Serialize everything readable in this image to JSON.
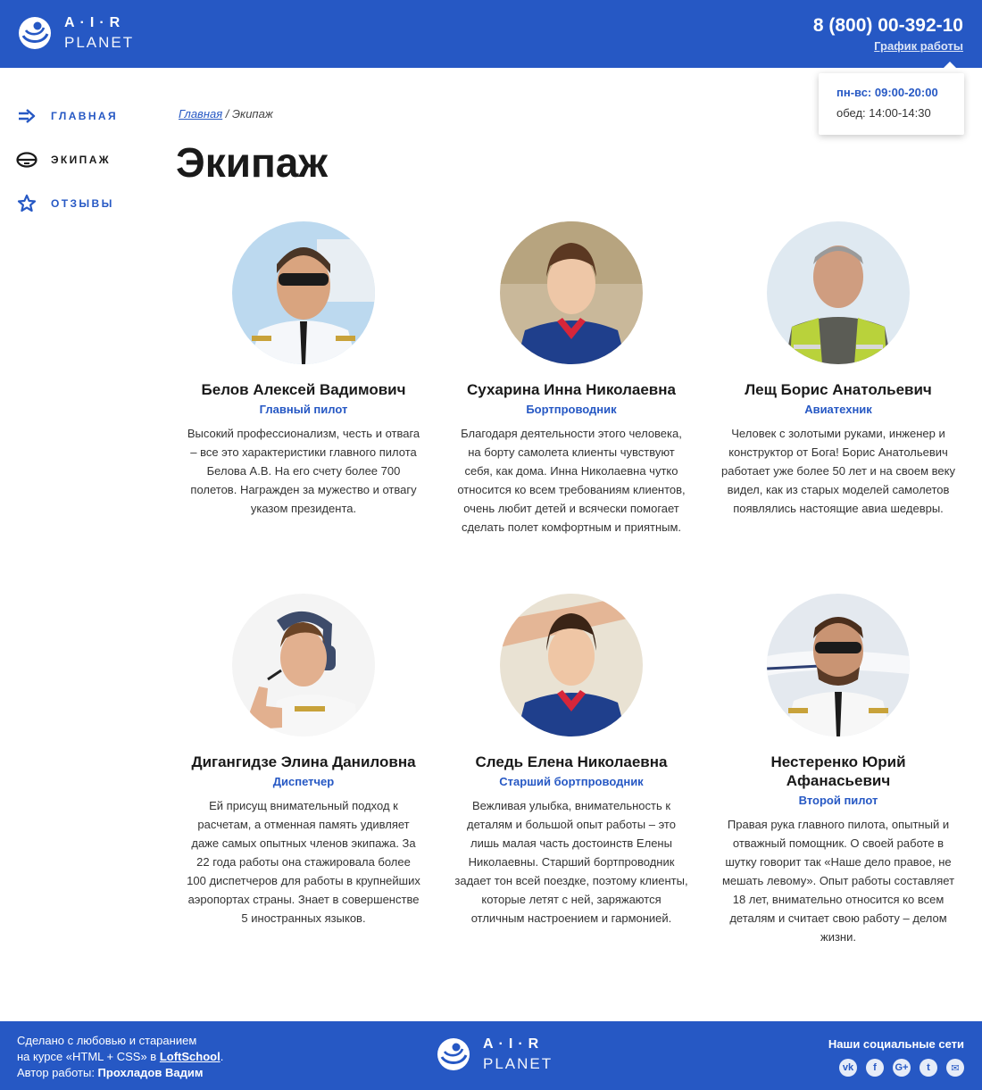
{
  "brand": {
    "line1": "A·I·R",
    "line2": "PLANET"
  },
  "header": {
    "phone": "8 (800) 00-392-10",
    "schedule_link": "График работы"
  },
  "schedule": {
    "days": "пн-вс: 09:00-20:00",
    "lunch": "обед: 14:00-14:30"
  },
  "nav": {
    "items": [
      {
        "label": "ГЛАВНАЯ",
        "icon": "arrow-right-icon"
      },
      {
        "label": "ЭКИПАЖ",
        "icon": "pilot-cap-icon"
      },
      {
        "label": "ОТЗЫВЫ",
        "icon": "star-icon"
      }
    ]
  },
  "breadcrumb": {
    "home": "Главная",
    "separator": " / ",
    "current": "Экипаж"
  },
  "page": {
    "title": "Экипаж"
  },
  "crew": [
    {
      "name": "Белов Алексей Вадимович",
      "role": "Главный пилот",
      "description": "Высокий профессионализм, честь и отвага – все это характеристики главного пилота Белова А.В. На его счету более 700 полетов. Награжден за мужество и отвагу указом президента."
    },
    {
      "name": "Сухарина Инна Николаевна",
      "role": "Бортпроводник",
      "description": "Благодаря деятельности этого человека, на борту самолета клиенты чувствуют себя, как дома. Инна Николаевна чутко относится ко всем требованиям клиентов, очень любит детей и всячески помогает сделать полет комфортным и приятным."
    },
    {
      "name": "Лещ Борис Анатольевич",
      "role": "Авиатехник",
      "description": "Человек с золотыми руками, инженер и конструктор от Бога! Борис Анатольевич работает уже более 50 лет и на своем веку видел, как из старых моделей самолетов появлялись настоящие авиа шедевры."
    },
    {
      "name": "Дигангидзе Элина Даниловна",
      "role": "Диспетчер",
      "description": "Ей присущ внимательный подход к расчетам, а отменная память удивляет даже самых опытных членов экипажа. За 22 года работы она стажировала более 100 диспетчеров для работы в крупнейших аэропортах страны.  Знает в совершенстве 5 иностранных языков."
    },
    {
      "name": "Следь Елена Николаевна",
      "role": "Старший бортпроводник",
      "description": "Вежливая улыбка, внимательность к деталям и большой опыт работы – это лишь малая часть достоинств Елены Николаевны. Старший бортпроводник задает тон всей поездке, поэтому клиенты, которые летят с ней, заряжаются отличным настроением и гармонией."
    },
    {
      "name": "Нестеренко Юрий Афанасьевич",
      "role": "Второй пилот",
      "description": "Правая рука главного пилота, опытный и отважный помощник. О своей работе в шутку говорит так «Наше дело правое, не мешать левому». Опыт работы составляет 18 лет, внимательно относится ко всем деталям и считает свою работу – делом жизни."
    }
  ],
  "footer": {
    "line1": "Сделано с любовью и старанием",
    "line2_prefix": "на курсе «HTML + CSS» в ",
    "school": "LoftSchool",
    "line2_suffix": ".",
    "author_prefix": "Автор работы: ",
    "author": "Прохладов Вадим",
    "social_title": "Наши социальные сети",
    "social": [
      {
        "icon": "vk-icon",
        "glyph": "vk"
      },
      {
        "icon": "facebook-icon",
        "glyph": "f"
      },
      {
        "icon": "google-plus-icon",
        "glyph": "G+"
      },
      {
        "icon": "twitter-icon",
        "glyph": "t"
      },
      {
        "icon": "mail-icon",
        "glyph": "✉"
      }
    ]
  },
  "colors": {
    "primary": "#2658c4",
    "text": "#1a1a1a"
  }
}
